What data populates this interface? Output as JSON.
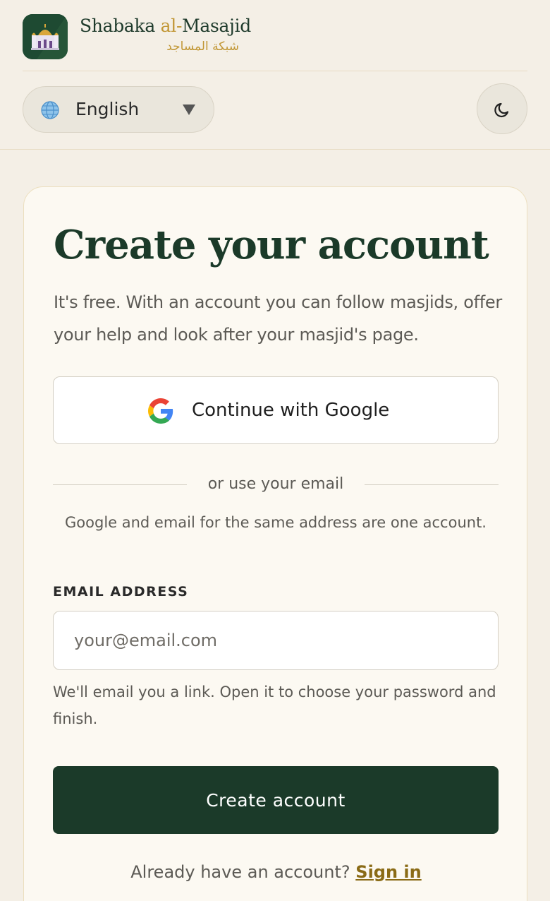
{
  "brand": {
    "name_prefix": "Shabaka ",
    "name_accent": "al-",
    "name_suffix": "Masajid",
    "arabic_name": "شبكة المساجد",
    "colors": {
      "primary": "#1b3a29",
      "accent": "#c19634"
    }
  },
  "language_selector": {
    "selected": "English",
    "icon": "globe-icon"
  },
  "theme_toggle": {
    "icon": "moon-icon"
  },
  "signup": {
    "title": "Create your account",
    "subtitle": "It's free. With an account you can follow masjids, offer your help and look after your masjid's page.",
    "google_button": "Continue with Google",
    "divider": "or use your email",
    "note": "Google and email for the same address are one account.",
    "email_label": "EMAIL ADDRESS",
    "email_placeholder": "your@email.com",
    "email_value": "",
    "email_hint": "We'll email you a link. Open it to choose your password and finish.",
    "submit": "Create account",
    "signin_prompt": "Already have an account?",
    "signin_link": "Sign in"
  }
}
